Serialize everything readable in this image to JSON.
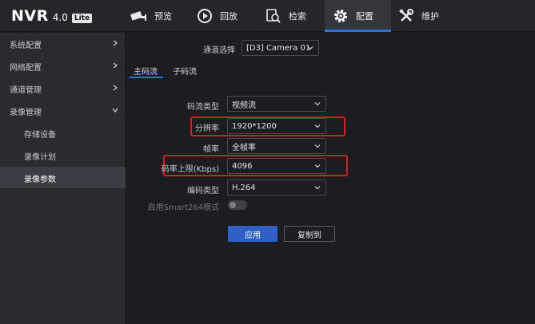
{
  "logo": {
    "main": "NVR",
    "version": "4.0",
    "badge": "Lite"
  },
  "nav": [
    {
      "label": "预览",
      "icon": "camera-icon"
    },
    {
      "label": "回放",
      "icon": "playback-icon"
    },
    {
      "label": "检索",
      "icon": "search-icon"
    },
    {
      "label": "配置",
      "icon": "gear-icon"
    },
    {
      "label": "维护",
      "icon": "tools-icon"
    }
  ],
  "sidebar": {
    "items": [
      {
        "label": "系统配置"
      },
      {
        "label": "网络配置"
      },
      {
        "label": "通道管理"
      },
      {
        "label": "录像管理"
      },
      {
        "label": "存储设备"
      },
      {
        "label": "录像计划"
      },
      {
        "label": "录像参数"
      }
    ]
  },
  "channel": {
    "label": "通道选择",
    "value": "[D3] Camera 01"
  },
  "tabs": {
    "main": "主码流",
    "sub": "子码流"
  },
  "form": {
    "stream_type": {
      "label": "码流类型",
      "value": "视频流"
    },
    "resolution": {
      "label": "分辨率",
      "value": "1920*1200"
    },
    "frame_rate": {
      "label": "帧率",
      "value": "全帧率"
    },
    "bitrate": {
      "label": "码率上限(Kbps)",
      "value": "4096"
    },
    "encoding": {
      "label": "编码类型",
      "value": "H.264"
    },
    "smart264": {
      "label": "启用Smart264模式",
      "enabled": false
    }
  },
  "buttons": {
    "apply": "应用",
    "copy": "复制到"
  },
  "colors": {
    "accent": "#2f6fde",
    "highlight": "#e5171d",
    "primary_button": "#2f5fc7"
  }
}
